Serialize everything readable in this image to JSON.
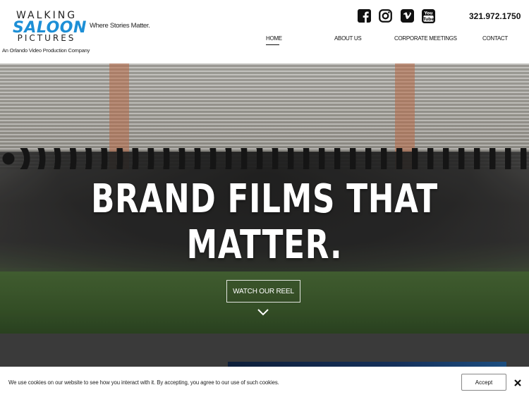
{
  "header": {
    "logo": {
      "line1": "WALKING",
      "line2": "SALOON",
      "line3": "PICTURES"
    },
    "tagline": "Where Stories Matter.",
    "subtitle": "An Orlando Video Production Company",
    "phone": "321.972.1750",
    "social": [
      {
        "icon": "facebook-icon"
      },
      {
        "icon": "instagram-icon"
      },
      {
        "icon": "vimeo-icon"
      },
      {
        "icon": "youtube-icon"
      }
    ],
    "nav": [
      {
        "label": "HOME",
        "active": true
      },
      {
        "label": "ABOUT US",
        "active": false
      },
      {
        "label": "CORPORATE MEETINGS",
        "active": false
      },
      {
        "label": "CONTACT",
        "active": false
      }
    ]
  },
  "hero": {
    "title": "BRAND FILMS THAT MATTER.",
    "button_label": "WATCH OUR REEL",
    "scroll_icon": "chevron-down-icon"
  },
  "cookie_bar": {
    "text": "We use cookies on our website to see how you interact with it. By accepting, you agree to our use of such cookies.",
    "accept_label": "Accept",
    "close_icon": "close-icon"
  },
  "colors": {
    "brand_blue": "#1d8fd6",
    "lower_section": "#3a3a3a"
  }
}
